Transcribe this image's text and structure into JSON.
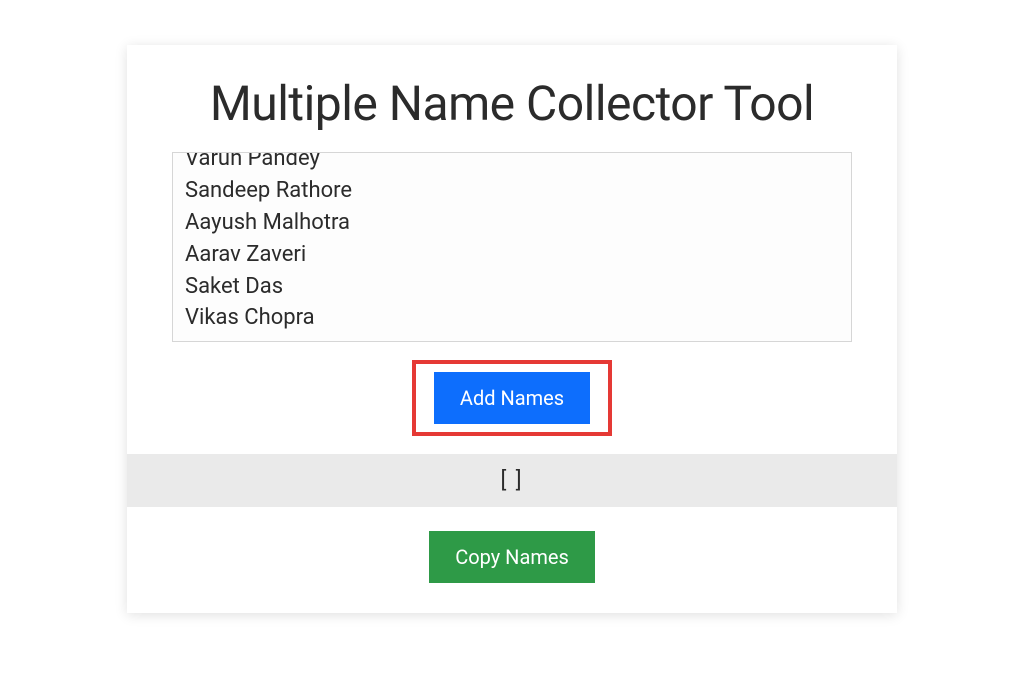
{
  "title": "Multiple Name Collector Tool",
  "textarea": {
    "value": "Varun Pandey\nSandeep Rathore\nAayush Malhotra\nAarav Zaveri\nSaket Das\nVikas Chopra"
  },
  "buttons": {
    "add": "Add Names",
    "copy": "Copy Names"
  },
  "output": "[ ]"
}
